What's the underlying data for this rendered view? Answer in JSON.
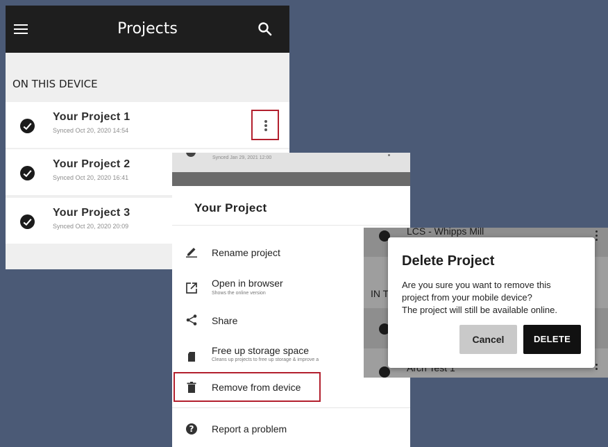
{
  "projects_screen": {
    "title": "Projects",
    "section": "ON THIS DEVICE",
    "projects": [
      {
        "name": "Your Project 1",
        "synced": "Synced Oct 20, 2020 14:54"
      },
      {
        "name": "Your Project 2",
        "synced": "Synced Oct 20, 2020 16:41"
      },
      {
        "name": "Your Project 3",
        "synced": "Synced Oct 20, 2020 20:09"
      }
    ]
  },
  "menu_screen": {
    "background_row_synced": "Synced Jan 29, 2021 12:00",
    "sheet_title": "Your Project",
    "items": [
      {
        "label": "Rename project",
        "subtitle": ""
      },
      {
        "label": "Open in browser",
        "subtitle": "Shows the online version"
      },
      {
        "label": "Share",
        "subtitle": ""
      },
      {
        "label": "Free up storage space",
        "subtitle": "Cleans up projects to free up storage & improve a"
      },
      {
        "label": "Remove from device",
        "subtitle": ""
      },
      {
        "label": "Report a problem",
        "subtitle": ""
      }
    ]
  },
  "delete_dialog": {
    "background_top_project": "LCS - Whipps Mill",
    "background_section": "IN T",
    "background_bottom_project": "Arch Test 1",
    "title": "Delete Project",
    "message_lines": [
      "Are you sure you want to remove this",
      "project from your mobile device?",
      "The project will still be available online."
    ],
    "cancel_label": "Cancel",
    "delete_label": "DELETE"
  },
  "colors": {
    "background": "#4b5a76",
    "appbar": "#1e1e1e",
    "highlight": "#b21f2d"
  }
}
